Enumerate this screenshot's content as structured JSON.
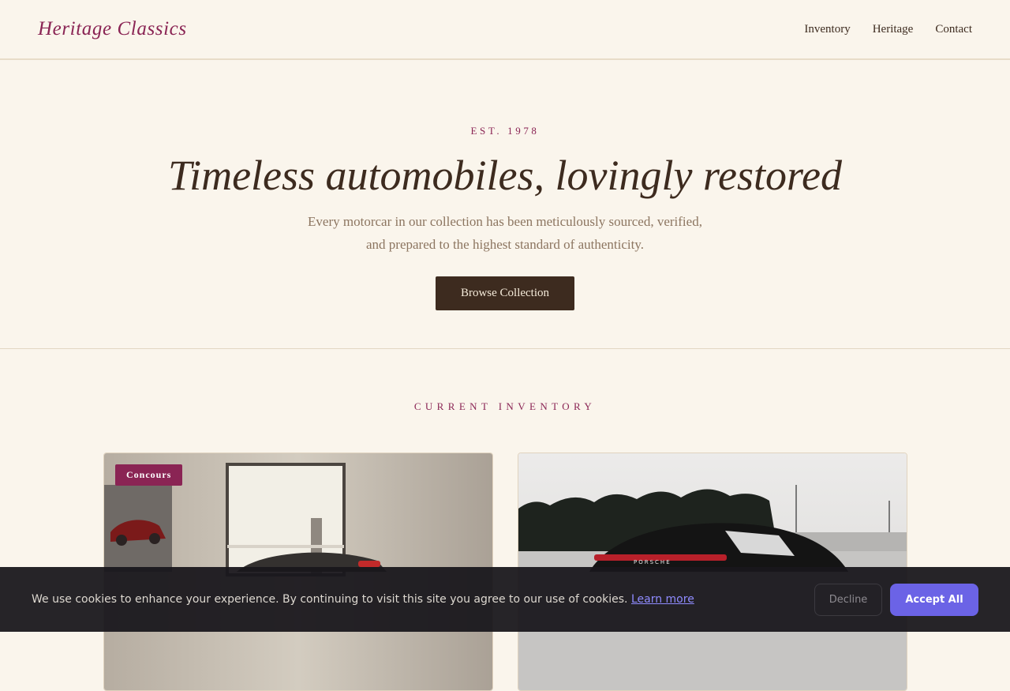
{
  "header": {
    "logo": "Heritage Classics",
    "nav": [
      "Inventory",
      "Heritage",
      "Contact"
    ]
  },
  "hero": {
    "eyebrow": "EST. 1978",
    "title": "Timeless automobiles, lovingly restored",
    "subtitle_line1": "Every motorcar in our collection has been meticulously sourced, verified,",
    "subtitle_line2": "and prepared to the highest standard of authenticity.",
    "cta": "Browse Collection"
  },
  "inventory": {
    "title": "CURRENT INVENTORY",
    "cards": [
      {
        "badge": "Concours",
        "photo": "silver-car-in-garage-photo"
      },
      {
        "photo": "black-porsche-rear-view-photo"
      }
    ]
  },
  "cookie_banner": {
    "text": "We use cookies to enhance your experience. By continuing to visit this site you agree to our use of cookies.",
    "link": "Learn more",
    "decline": "Decline",
    "accept": "Accept All"
  },
  "colors": {
    "background": "#faf5ec",
    "accent": "#8a2454",
    "dark": "#3d2b1f",
    "accept_button": "#6b63e6"
  }
}
